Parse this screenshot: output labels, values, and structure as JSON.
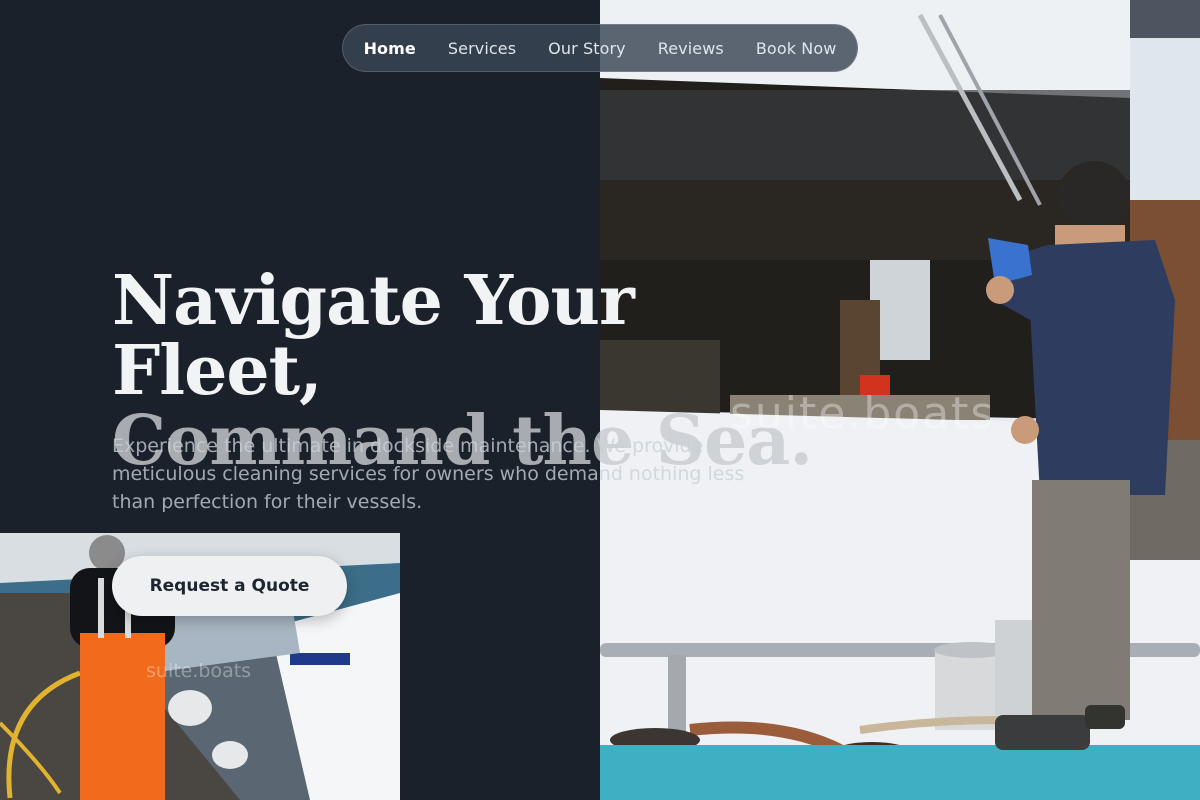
{
  "nav": {
    "items": [
      {
        "label": "Home",
        "active": true
      },
      {
        "label": "Services",
        "active": false
      },
      {
        "label": "Our Story",
        "active": false
      },
      {
        "label": "Reviews",
        "active": false
      },
      {
        "label": "Book Now",
        "active": false
      }
    ]
  },
  "hero": {
    "headline_line1": "Navigate Your Fleet,",
    "headline_line2": "Command the Sea.",
    "subtext": "Experience the ultimate in dockside maintenance. We provide meticulous cleaning services for owners who demand nothing less than perfection for their vessels.",
    "cta_label": "Request a Quote"
  },
  "watermarks": {
    "hero": "suite.boats",
    "dock": "suite.boats"
  },
  "colors": {
    "background": "#1a212b",
    "nav_pill": "#3a4656",
    "cta_bg": "#eef0f2",
    "cta_text": "#1d2530"
  }
}
